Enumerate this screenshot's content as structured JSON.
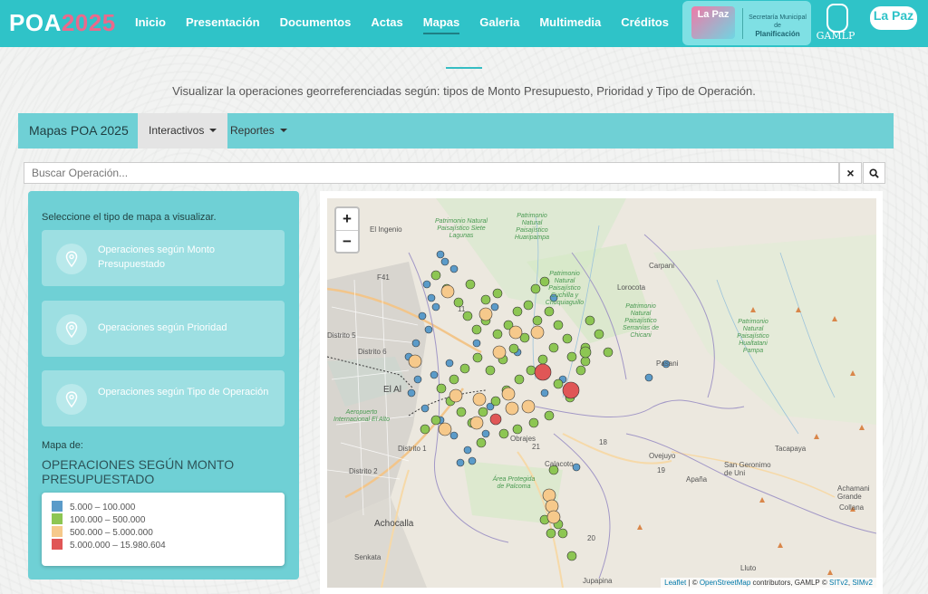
{
  "brand": {
    "part1": "POA",
    "part2": "2025"
  },
  "nav": {
    "items": [
      "Inicio",
      "Presentación",
      "Documentos",
      "Actas",
      "Mapas",
      "Galeria",
      "Multimedia",
      "Créditos"
    ],
    "active": "Mapas"
  },
  "logos": {
    "lapaz": "La Paz",
    "secretaria_line1": "Secretaría Municipal de",
    "secretaria_line2": "Planificación",
    "gamlp": "GAMLP",
    "lapaz2": "La Paz"
  },
  "subtitle": "Visualizar la operaciones georreferenciadas según: tipos de Monto Presupuesto, Prioridad y Tipo de Operación.",
  "toolbar": {
    "title": "Mapas POA 2025",
    "dropdown1": "Interactivos",
    "dropdown2": "Reportes"
  },
  "search": {
    "placeholder": "Buscar Operación...",
    "clear_icon": "×",
    "search_icon": "search"
  },
  "panel": {
    "prompt": "Seleccione el tipo de mapa a visualizar.",
    "options": [
      {
        "label": "Operaciones según Monto Presupuestado"
      },
      {
        "label": "Operaciones según Prioridad"
      },
      {
        "label": "Operaciones según Tipo de Operación"
      }
    ],
    "mapa_de_label": "Mapa de:",
    "mapa_name": "OPERACIONES SEGÚN MONTO PRESUPUESTADO"
  },
  "legend": [
    {
      "label": "5.000 – 100.000",
      "color": "#5b9bc9"
    },
    {
      "label": "100.000 – 500.000",
      "color": "#8dc653"
    },
    {
      "label": "500.000 – 5.000.000",
      "color": "#f6c98b"
    },
    {
      "label": "5.000.000 – 15.980.604",
      "color": "#e05656"
    }
  ],
  "map": {
    "zoom_in": "+",
    "zoom_out": "−",
    "attribution": {
      "leaflet": "Leaflet",
      "sep": " | © ",
      "osm": "OpenStreetMap",
      "contrib": " contributors, GAMLP © ",
      "sit": "SITv2",
      "comma": ", ",
      "sim": "SIMv2"
    },
    "labels": {
      "el_ingenio": "El Ingenio",
      "f41": "F41",
      "distrito5": "Distrito 5",
      "distrito6": "Distrito 6",
      "el_alto": "El Al",
      "aeropuerto": "Aeropuerto Internacional El Alto",
      "distrito1": "Distrito 1",
      "distrito2": "Distrito 2",
      "achocalla": "Achocalla",
      "senkata": "Senkata",
      "obrajes": "Obrajes",
      "calacoto": "Calacoto",
      "n21": "21",
      "n18": "18",
      "n19": "19",
      "n20": "20",
      "n11": "11",
      "ovejuyo": "Ovejuyo",
      "apana": "Apaña",
      "carpani": "Carpani",
      "lorocota": "Lorocota",
      "pasani": "Pasani",
      "tacapaya": "Tacapaya",
      "san_geronimo": "San Geronimo de Uni",
      "achumani_grande": "Achamani Grande",
      "collana": "Collana",
      "lluto": "Lluto",
      "jupapina": "Jupapina",
      "area_prot": "Área Protegida de Palcoma",
      "patrimonio1": "Patrimonio Natural Paisajístico Siete Lagunas",
      "patrimonio2": "Patrimonio Natural Paisajístico Huaripampa",
      "patrimonio3": "Patrimonio Natural Paisajístico Cuchilla y Chuquiaguillo",
      "patrimonio4": "Patrimonio Natural Paisajístico Serranías de Chicani",
      "patrimonio5": "Patrimonio Natural Paisajístico Hualtatani Pampa"
    }
  }
}
